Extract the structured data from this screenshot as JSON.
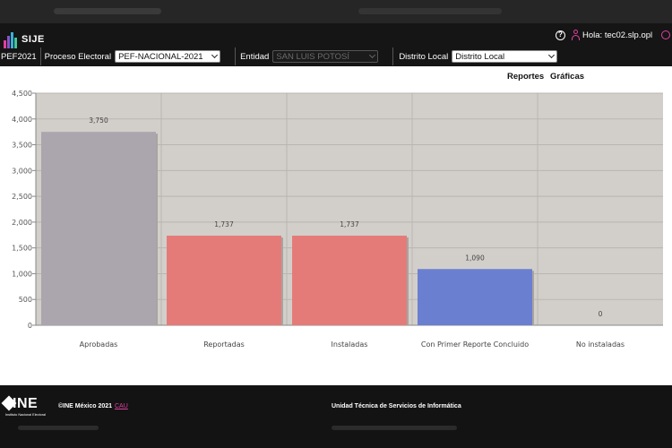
{
  "app": {
    "logo_text": "SIJE"
  },
  "header": {
    "help_icon": "help-circle-icon",
    "user_icon": "user-icon",
    "greeting": "Hola: tec02.slp.opl",
    "power_icon": "power-icon"
  },
  "filters": {
    "year_label": "PEF2021",
    "proceso_label": "Proceso Electoral",
    "proceso_value": "PEF-NACIONAL-2021",
    "entidad_label": "Entidad",
    "entidad_value": "SAN LUIS POTOSÍ",
    "distrito_label": "Distrito Local",
    "distrito_value": "Distrito Local"
  },
  "nav": {
    "reportes": "Reportes",
    "graficas": "Gráficas"
  },
  "chart_data": {
    "type": "bar",
    "categories": [
      "Aprobadas",
      "Reportadas",
      "Instaladas",
      "Con Primer Reporte Concluido",
      "No instaladas"
    ],
    "values": [
      3750,
      1737,
      1737,
      1090,
      0
    ],
    "value_labels": [
      "3,750",
      "1,737",
      "1,737",
      "1,090",
      "0"
    ],
    "colors": [
      "#aba5ad",
      "#e57b79",
      "#e57b79",
      "#6a7fd0",
      "#aaaaaa"
    ],
    "yticks": [
      "0",
      "500",
      "1,000",
      "1,500",
      "2,000",
      "2,500",
      "3,000",
      "3,500",
      "4,000",
      "4,500"
    ],
    "ylim": [
      0,
      4500
    ],
    "ystep": 500,
    "background": "#d2cfca",
    "grid": true
  },
  "footer": {
    "ine": "INE",
    "ine_sub": "Instituto Nacional Electoral",
    "copyright": "©INE México 2021",
    "cau": "CAU",
    "unit": "Unidad Técnica de Servicios de Informática"
  }
}
